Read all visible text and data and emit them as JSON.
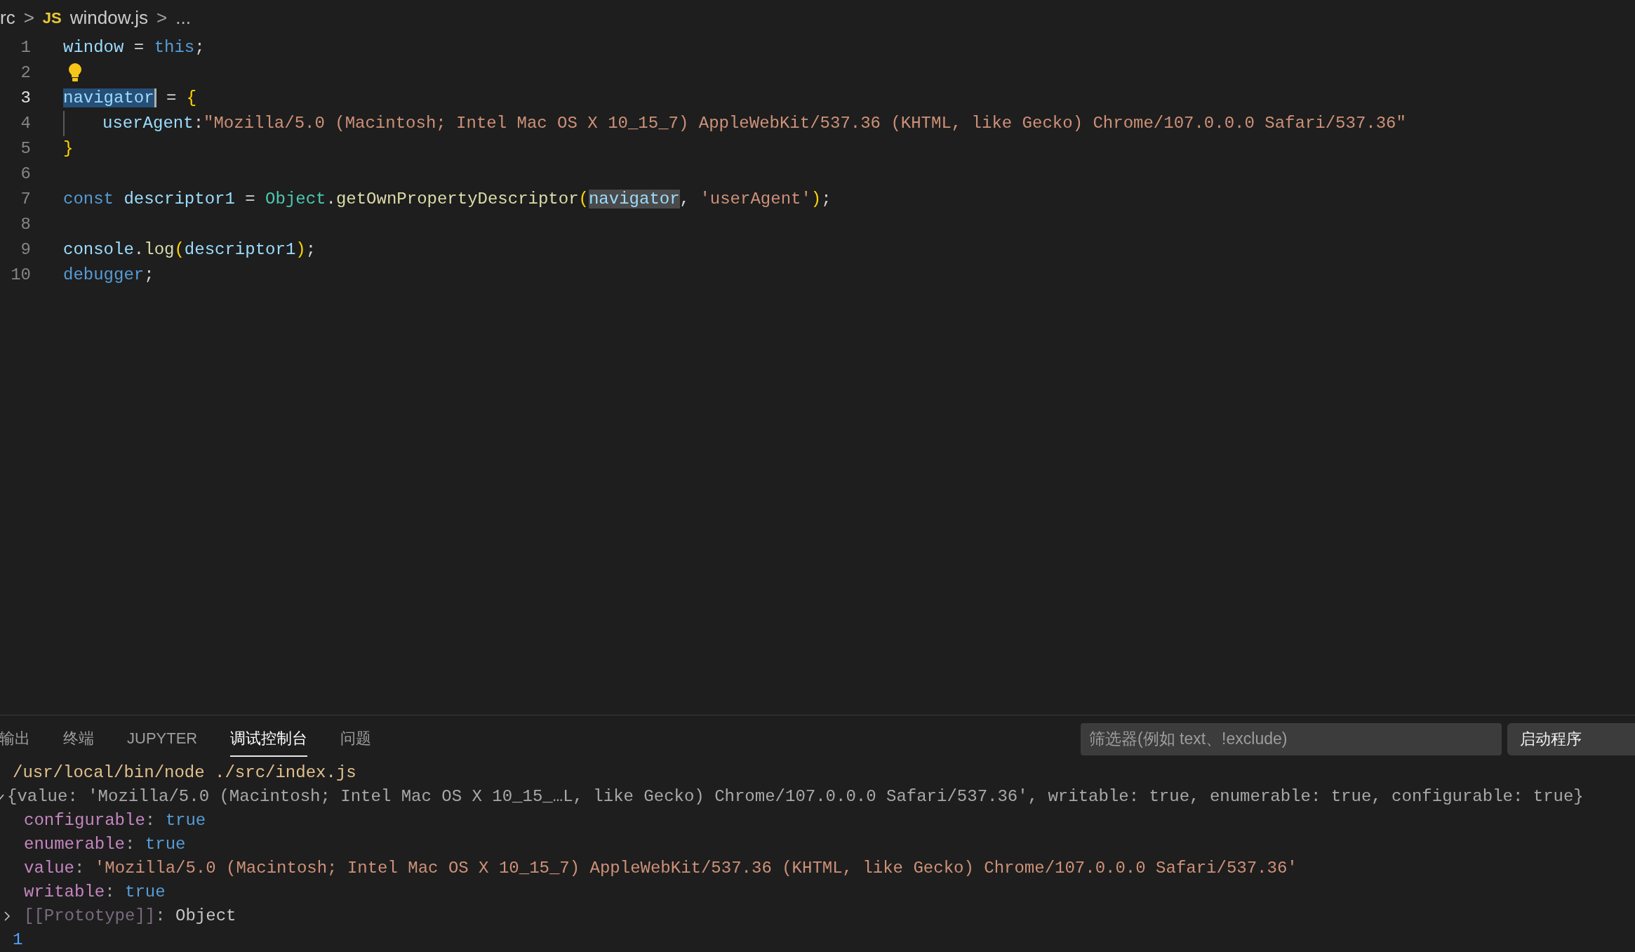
{
  "breadcrumb": {
    "items": [
      {
        "label": "rc",
        "kind": "folder"
      },
      {
        "label": "window.js",
        "kind": "file",
        "badge": "JS"
      },
      {
        "label": "...",
        "kind": "symbol"
      }
    ],
    "separator": ">"
  },
  "editor": {
    "lines": [
      {
        "number": "1",
        "current": false,
        "tokens": [
          {
            "text": "window",
            "kind": "var"
          },
          {
            "text": " = ",
            "kind": "plain"
          },
          {
            "text": "this",
            "kind": "keyword"
          },
          {
            "text": ";",
            "kind": "plain"
          }
        ]
      },
      {
        "number": "2",
        "current": false,
        "lightbulb": true
      },
      {
        "number": "3",
        "current": true,
        "tokens": [
          {
            "text": "navigator",
            "kind": "var",
            "selected": true
          },
          {
            "text": " = ",
            "kind": "plain"
          },
          {
            "text": "{",
            "kind": "brace"
          }
        ]
      },
      {
        "number": "4",
        "current": false,
        "indent": true,
        "tokens": [
          {
            "text": "userAgent",
            "kind": "var"
          },
          {
            "text": ":",
            "kind": "plain"
          },
          {
            "text": "\"Mozilla/5.0 (Macintosh; Intel Mac OS X 10_15_7) AppleWebKit/537.36 (KHTML, like Gecko) Chrome/107.0.0.0 Safari/537.36\"",
            "kind": "string"
          }
        ]
      },
      {
        "number": "5",
        "current": false,
        "tokens": [
          {
            "text": "}",
            "kind": "brace"
          }
        ]
      },
      {
        "number": "6",
        "current": false
      },
      {
        "number": "7",
        "current": false,
        "tokens": [
          {
            "text": "const ",
            "kind": "keyword"
          },
          {
            "text": "descriptor1",
            "kind": "var"
          },
          {
            "text": " = ",
            "kind": "plain"
          },
          {
            "text": "Object",
            "kind": "type"
          },
          {
            "text": ".",
            "kind": "plain"
          },
          {
            "text": "getOwnPropertyDescriptor",
            "kind": "func"
          },
          {
            "text": "(",
            "kind": "brace"
          },
          {
            "text": "navigator",
            "kind": "var",
            "occurrence": true
          },
          {
            "text": ", ",
            "kind": "plain"
          },
          {
            "text": "'userAgent'",
            "kind": "string"
          },
          {
            "text": ")",
            "kind": "brace"
          },
          {
            "text": ";",
            "kind": "plain"
          }
        ]
      },
      {
        "number": "8",
        "current": false
      },
      {
        "number": "9",
        "current": false,
        "tokens": [
          {
            "text": "console",
            "kind": "var"
          },
          {
            "text": ".",
            "kind": "plain"
          },
          {
            "text": "log",
            "kind": "func"
          },
          {
            "text": "(",
            "kind": "brace"
          },
          {
            "text": "descriptor1",
            "kind": "var"
          },
          {
            "text": ")",
            "kind": "brace"
          },
          {
            "text": ";",
            "kind": "plain"
          }
        ]
      },
      {
        "number": "10",
        "current": false,
        "tokens": [
          {
            "text": "debugger",
            "kind": "keyword"
          },
          {
            "text": ";",
            "kind": "plain"
          }
        ]
      }
    ]
  },
  "panel": {
    "tabs": [
      {
        "label": "输出",
        "selected": false
      },
      {
        "label": "终端",
        "selected": false
      },
      {
        "label": "JUPYTER",
        "selected": false
      },
      {
        "label": "调试控制台",
        "selected": true
      },
      {
        "label": "问题",
        "selected": false
      }
    ],
    "filter": {
      "placeholder": "筛选器(例如 text、!exclude)"
    },
    "launch_config": "启动程序",
    "console": [
      {
        "kind": "path",
        "text": "/usr/local/bin/node ./src/index.js"
      },
      {
        "kind": "object",
        "expanded": true,
        "text": "{value: 'Mozilla/5.0 (Macintosh; Intel Mac OS X 10_15_…L, like Gecko) Chrome/107.0.0.0 Safari/537.36', writable: true, enumerable: true, configurable: true}"
      },
      {
        "kind": "boolean-property",
        "key": "configurable",
        "separator": ":",
        "value": "true"
      },
      {
        "kind": "boolean-property",
        "key": "enumerable",
        "separator": ":",
        "value": "true"
      },
      {
        "kind": "string-property",
        "key": "value",
        "separator": ":",
        "value": "'Mozilla/5.0 (Macintosh; Intel Mac OS X 10_15_7) AppleWebKit/537.36 (KHTML, like Gecko) Chrome/107.0.0.0 Safari/537.36'"
      },
      {
        "kind": "boolean-property",
        "key": "writable",
        "separator": ":",
        "value": "true"
      },
      {
        "kind": "prototype",
        "expanded": false,
        "key": "[[Prototype]]",
        "separator": ":",
        "value": "Object"
      },
      {
        "kind": "number",
        "text": "1"
      }
    ]
  }
}
